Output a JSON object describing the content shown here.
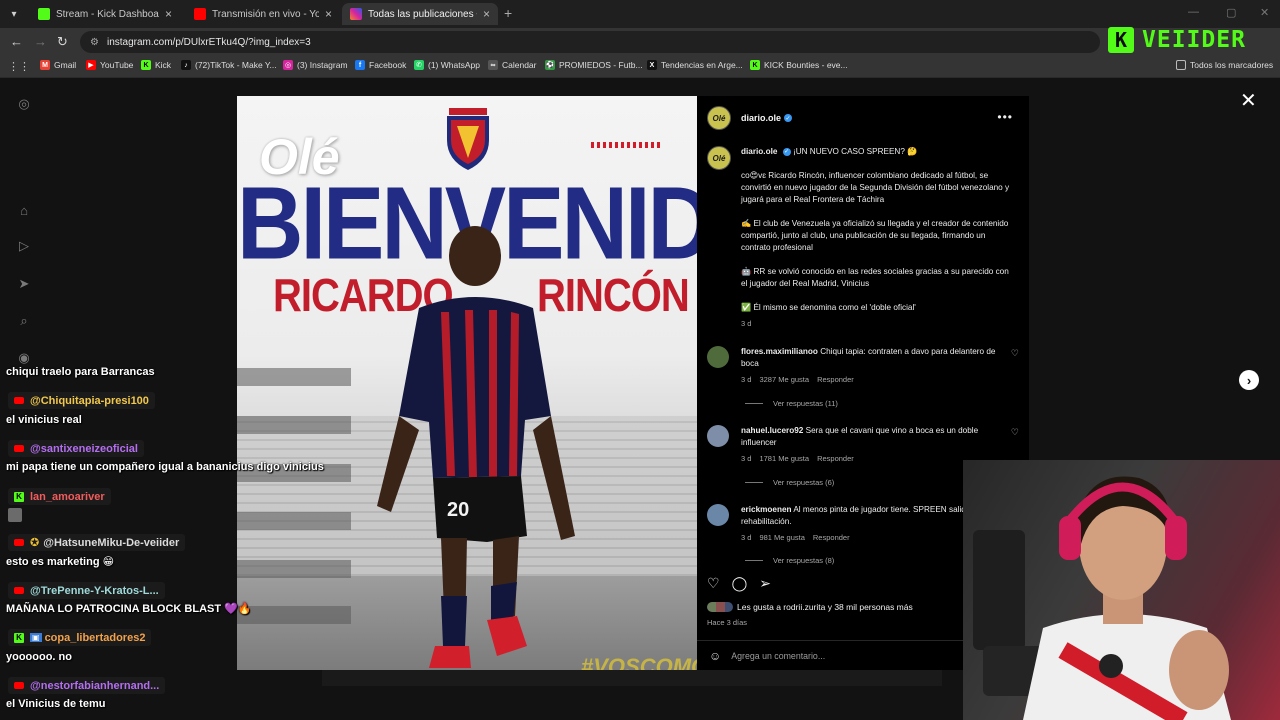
{
  "browser": {
    "tabs": [
      {
        "title": "Stream - Kick Dashboard",
        "favicon_color": "#53fc18",
        "active": false
      },
      {
        "title": "Transmisión en vivo - YouTube",
        "favicon_color": "#ff0000",
        "active": false
      },
      {
        "title": "Todas las publicaciones • Instag",
        "favicon_color": "#d6249f",
        "active": true
      }
    ],
    "url": "instagram.com/p/DUlxrETku4Q/?img_index=3",
    "bookmarks": [
      {
        "label": "Gmail",
        "icon": "gmail-icon",
        "color": "#ea4335",
        "glyph": "M"
      },
      {
        "label": "YouTube",
        "icon": "youtube-icon",
        "color": "#ff0000",
        "glyph": "▶"
      },
      {
        "label": "Kick",
        "icon": "kick-icon",
        "color": "#53fc18",
        "glyph": "K"
      },
      {
        "label": "(72)TikTok - Make Y...",
        "icon": "tiktok-icon",
        "color": "#111111",
        "glyph": "♪"
      },
      {
        "label": "(3) Instagram",
        "icon": "instagram-icon",
        "color": "#d6249f",
        "glyph": "◎"
      },
      {
        "label": "Facebook",
        "icon": "facebook-icon",
        "color": "#1877f2",
        "glyph": "f"
      },
      {
        "label": "(1) WhatsApp",
        "icon": "whatsapp-icon",
        "color": "#25d366",
        "glyph": "✆"
      },
      {
        "label": "Calendar",
        "icon": "calendar-icon",
        "color": "#555555",
        "glyph": "∞"
      },
      {
        "label": "PROMIEDOS - Futb...",
        "icon": "promiedos-icon",
        "color": "#2e9e3e",
        "glyph": "⚽"
      },
      {
        "label": "Tendencias en Arge...",
        "icon": "x-icon",
        "color": "#111111",
        "glyph": "X"
      },
      {
        "label": "KICK Bounties - eve...",
        "icon": "kick-icon",
        "color": "#53fc18",
        "glyph": "K"
      }
    ],
    "all_bookmarks": "Todos los marcadores"
  },
  "kick_badge": {
    "letter": "K",
    "name": "VEIIDER",
    "color": "#53fc18"
  },
  "post_image": {
    "logo": "Olé",
    "headline": "BIENVENIDO",
    "first_name": "RICARDO",
    "last_name": "RINCÓN",
    "hashtag": "#VOSCOMOLA",
    "jersey_number": "20"
  },
  "post": {
    "author": "diario.ole",
    "avatar_text": "Olé",
    "caption_title": "¡UN NUEVO CASO SPREEN? 🤔",
    "caption_p1": "co😍vɛ Ricardo Rincón, influencer colombiano dedicado al fútbol, se convirtió en nuevo jugador de la Segunda División del fútbol venezolano y jugará para el Real Frontera de Táchira",
    "caption_p2": "✍️ El club de Venezuela ya oficializó su llegada y el creador de contenido compartió, junto al club, una publicación de su llegada, firmando un contrato profesional",
    "caption_p3": "🤖 RR se volvió conocido en las redes sociales gracias a su parecido con el jugador del Real Madrid, Vinicius",
    "caption_p4": "✅ Él mismo se denomina como el 'doble oficial'",
    "caption_time": "3 d",
    "comments": [
      {
        "user": "flores.maximilianoo",
        "text": "Chiqui tapia: contraten a davo para delantero de boca",
        "time": "3 d",
        "likes": "3287 Me gusta",
        "reply": "Responder",
        "view_replies": "Ver respuestas (11)",
        "avatar_color": "#4f6b3c"
      },
      {
        "user": "nahuel.lucero92",
        "text": "Sera que el cavani que vino a boca es un doble influencer",
        "time": "3 d",
        "likes": "1781 Me gusta",
        "reply": "Responder",
        "view_replies": "Ver respuestas (6)",
        "avatar_color": "#7e8ea8"
      },
      {
        "user": "erickmoenen",
        "text": "Al menos pinta de jugador tiene. SPREEN salido de rehabilitación.",
        "time": "3 d",
        "likes": "981 Me gusta",
        "reply": "Responder",
        "view_replies": "Ver respuestas (8)",
        "avatar_color": "#6a87a8"
      }
    ],
    "likes_text": "Les gusta a rodrii.zurita y 38 mil personas más",
    "posted": "Hace 3 días",
    "comment_placeholder": "Agrega un comentario..."
  },
  "chat": [
    {
      "type": "msg",
      "text": "chiqui traelo para Barrancas"
    },
    {
      "type": "user",
      "platform": "youtube",
      "name": "@Chiquitapia-presi100",
      "color": "#f2c84b"
    },
    {
      "type": "msg",
      "text": "el vinicius real"
    },
    {
      "type": "user",
      "platform": "youtube",
      "name": "@santixeneizeoficial",
      "color": "#b46ef0"
    },
    {
      "type": "msg",
      "text": "mi papa tiene un compañero igual a bananicius digo vinicius"
    },
    {
      "type": "user",
      "platform": "kick",
      "name": "lan_amoariver",
      "color": "#f25c5c"
    },
    {
      "type": "user",
      "platform": "youtube",
      "name": "@HatsuneMiku-De-veiider",
      "color": "#dcdcdc"
    },
    {
      "type": "msg",
      "text": "esto es marketing 😁"
    },
    {
      "type": "user",
      "platform": "youtube",
      "name": "@TrePenne-Y-Kratos-L...",
      "color": "#9fd9d9"
    },
    {
      "type": "msg",
      "text": "MAÑANA LO PATROCINA BLOCK BLAST 💜🔥"
    },
    {
      "type": "user",
      "platform": "kick",
      "name": "copa_libertadores2",
      "color": "#f2a24b"
    },
    {
      "type": "msg",
      "text": "yoooooo. no"
    },
    {
      "type": "user",
      "platform": "youtube",
      "name": "@nestorfabianhernand...",
      "color": "#b46ef0"
    },
    {
      "type": "msg",
      "text": "el Vinicius de temu"
    }
  ]
}
